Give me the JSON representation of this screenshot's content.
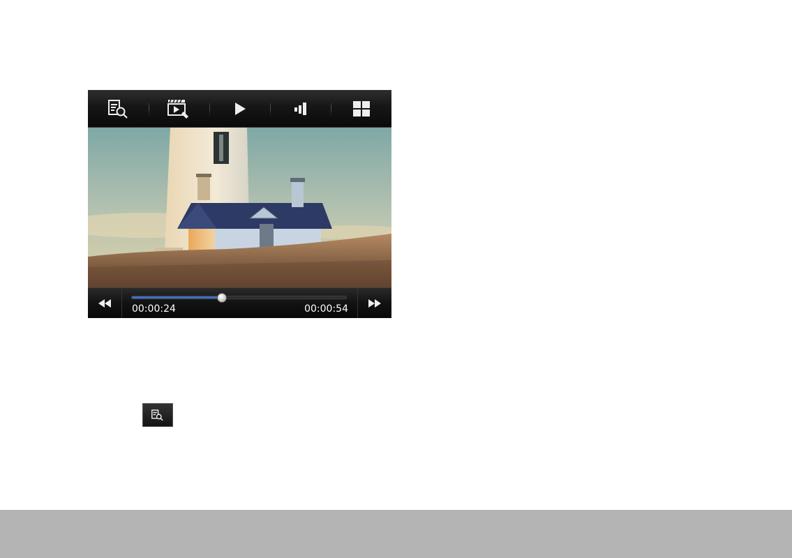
{
  "player": {
    "toolbar": {
      "buttons": [
        {
          "icon": "info-search-icon"
        },
        {
          "icon": "video-edit-icon"
        },
        {
          "icon": "play-icon"
        },
        {
          "icon": "volume-icon"
        },
        {
          "icon": "grid-view-icon"
        }
      ]
    },
    "video": {
      "scene": "lighthouse-with-house-on-grass"
    },
    "seekbar": {
      "current_time": "00:00:24",
      "duration": "00:00:54",
      "progress": 0.42,
      "accent": "#3a6fc4"
    },
    "nav": {
      "rewind_icon": "rewind-icon",
      "fast_forward_icon": "fast-forward-icon"
    }
  },
  "standalone_button": {
    "icon": "info-search-icon"
  },
  "colors": {
    "footer_bar": "#b3b4b3",
    "toolbar_bg": "#161616"
  }
}
